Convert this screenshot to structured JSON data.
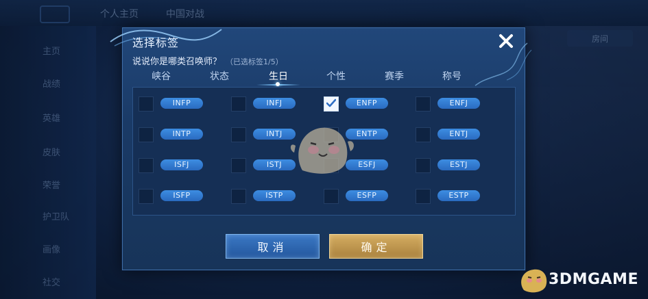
{
  "background": {
    "top_tabs": [
      "个人主页",
      "中国对战"
    ],
    "side_items": [
      "主页",
      "战绩",
      "英雄",
      "皮肤",
      "荣誉",
      "护卫队",
      "画像",
      "社交"
    ],
    "right_label": "房间"
  },
  "dialog": {
    "title": "选择标签",
    "subtitle": "说说你是哪类召唤师？",
    "selected_count": "（已选标签1/5）",
    "tabs": [
      {
        "label": "峡谷",
        "active": false
      },
      {
        "label": "状态",
        "active": false
      },
      {
        "label": "生日",
        "active": true
      },
      {
        "label": "个性",
        "active": false
      },
      {
        "label": "赛季",
        "active": false
      },
      {
        "label": "称号",
        "active": false
      }
    ],
    "tags": [
      {
        "label": "INFP",
        "checked": false
      },
      {
        "label": "INFJ",
        "checked": false
      },
      {
        "label": "ENFP",
        "checked": true
      },
      {
        "label": "ENFJ",
        "checked": false
      },
      {
        "label": "INTP",
        "checked": false
      },
      {
        "label": "INTJ",
        "checked": false
      },
      {
        "label": "ENTP",
        "checked": false
      },
      {
        "label": "ENTJ",
        "checked": false
      },
      {
        "label": "ISFJ",
        "checked": false
      },
      {
        "label": "ISTJ",
        "checked": false
      },
      {
        "label": "ESFJ",
        "checked": false
      },
      {
        "label": "ESTJ",
        "checked": false
      },
      {
        "label": "ISFP",
        "checked": false
      },
      {
        "label": "ISTP",
        "checked": false
      },
      {
        "label": "ESFP",
        "checked": false
      },
      {
        "label": "ESTP",
        "checked": false
      }
    ],
    "cancel_label": "取消",
    "confirm_label": "确定",
    "close_icon": "close-icon"
  },
  "watermark": {
    "text": "3DMGAME"
  },
  "colors": {
    "accent_blue": "#3d8de2",
    "confirm_gold": "#d5ad62",
    "dialog_bg": "#1a3a66"
  }
}
